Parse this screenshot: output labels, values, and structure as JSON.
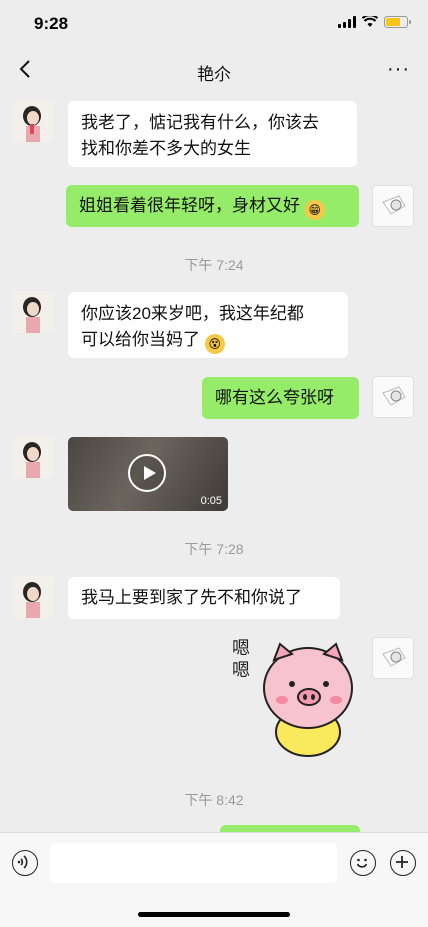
{
  "status": {
    "time": "9:28"
  },
  "nav": {
    "title": "艳尒",
    "more": "···"
  },
  "messages": {
    "m1": "我老了，惦记我有什么，你该去",
    "m1b": "找和你差不多大的女生",
    "m2": "姐姐看着很年轻呀，身材又好",
    "t1": "下午 7:24",
    "m3": "你应该20来岁吧，我这年纪都",
    "m3b": "可以给你当妈了",
    "m4": "哪有这么夸张呀",
    "video_duration": "0:05",
    "t2": "下午 7:28",
    "m5": "我马上要到家了先不和你说了",
    "sticker_text": "嗯嗯",
    "t3": "下午 8:42"
  },
  "icons": {
    "back": "chevron-left-icon",
    "voice": "voice-icon",
    "emoji": "smile-icon",
    "add": "plus-icon"
  },
  "colors": {
    "bg": "#ededed",
    "bubble_right": "#95ec69",
    "bubble_left": "#ffffff"
  }
}
